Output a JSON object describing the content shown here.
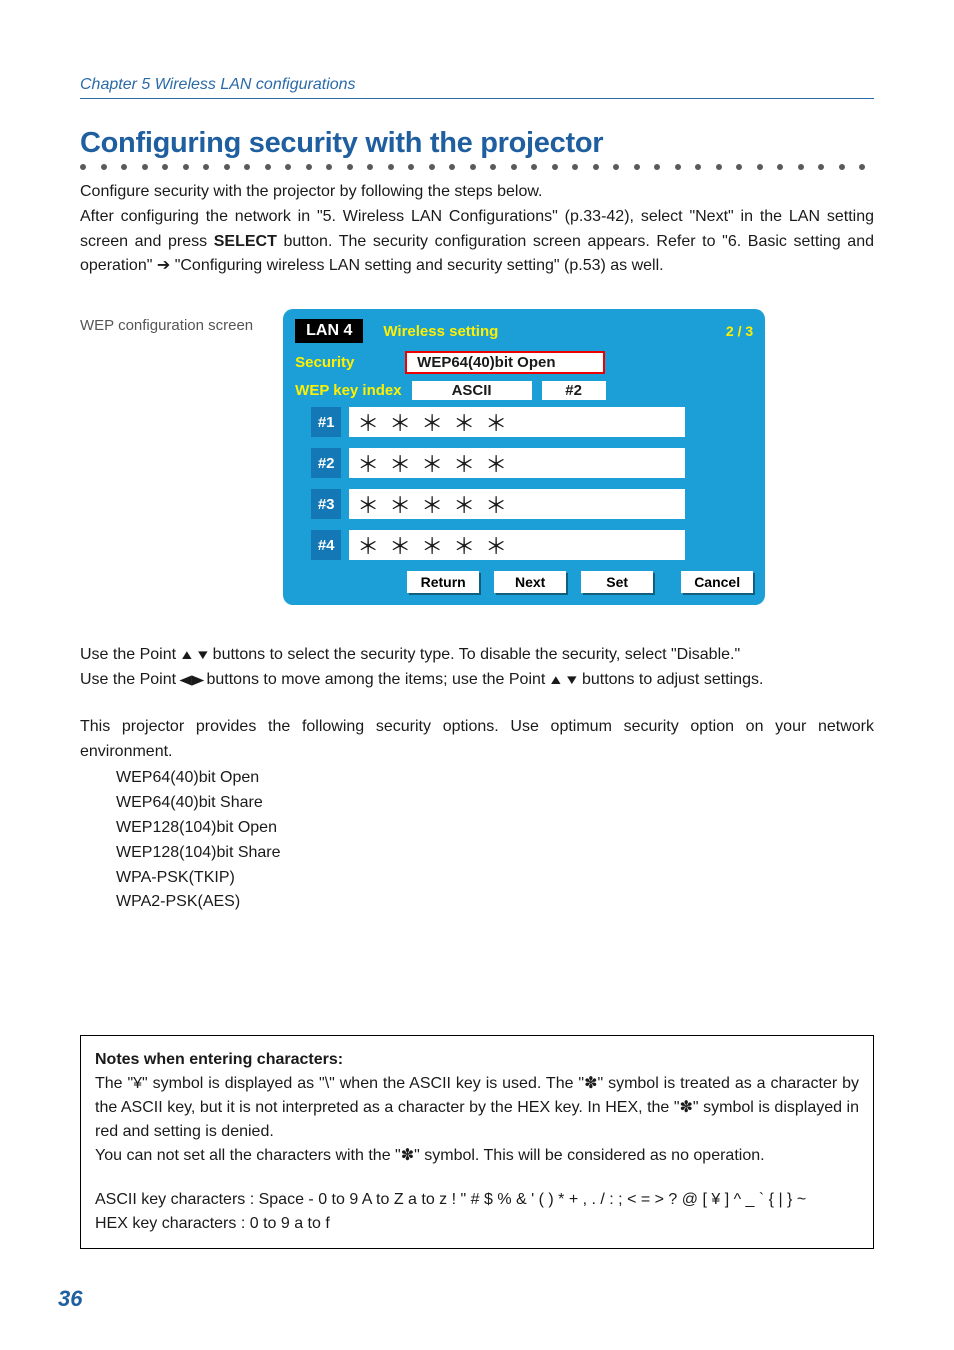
{
  "chapter": "Chapter 5 Wireless LAN configurations",
  "section_title": "Configuring security with the projector",
  "intro": {
    "line1": "Configure security with the projector by following the steps below.",
    "line2a": "After configuring the network in \"5. Wireless LAN Configurations\" (p.33-42), select \"Next\" in the LAN setting screen and press ",
    "line2b_bold": "SELECT",
    "line2c": " button. The security configuration screen appears. Refer to \"6. Basic setting and operation\" ",
    "arrow": "➔",
    "line2d": " \"Configuring wireless LAN setting and security setting\" (p.53) as well."
  },
  "screenshot_caption": "WEP configuration screen",
  "dialog": {
    "lan_label": "LAN 4",
    "wireless_setting": "Wireless setting",
    "page_indicator": "2 / 3",
    "security_label": "Security",
    "security_value": "WEP64(40)bit Open",
    "wep_index_label": "WEP key index",
    "ascii_label": "ASCII",
    "idx_value": "#2",
    "keys": [
      {
        "num": "#1",
        "value": "＊＊＊＊＊"
      },
      {
        "num": "#2",
        "value": "＊＊＊＊＊"
      },
      {
        "num": "#3",
        "value": "＊＊＊＊＊"
      },
      {
        "num": "#4",
        "value": "＊＊＊＊＊"
      }
    ],
    "buttons": {
      "return": "Return",
      "next": "Next",
      "set": "Set",
      "cancel": "Cancel"
    }
  },
  "body": {
    "p1a": "Use the Point ",
    "p1_ud": "▲▼",
    "p1b": " buttons to select the security type. To disable the security, select \"Disable.\"",
    "p2a": "Use the Point ",
    "p2_lr": "◀▶",
    "p2b": " buttons to move among the items; use the Point ",
    "p2_ud": "▲▼",
    "p2c": " buttons to adjust settings.",
    "p3": "This projector provides the following security options. Use optimum security option on your network environment.",
    "options": [
      "WEP64(40)bit Open",
      "WEP64(40)bit Share",
      "WEP128(104)bit Open",
      "WEP128(104)bit Share",
      "WPA-PSK(TKIP)",
      "WPA2-PSK(AES)"
    ]
  },
  "note": {
    "title": "Notes when entering characters:",
    "p1": "The \"¥\" symbol is displayed as \"\\\" when the ASCII key is used. The \"✽\" symbol is treated as a character by the ASCII key, but it is not interpreted as a character by the HEX key. In HEX, the \"✽\" symbol is displayed in red and setting is denied.",
    "p2": "You can not set all the characters with the \"✽\" symbol. This will be considered as no operation.",
    "p3": "ASCII key characters : Space - 0 to 9 A to Z a to z ! \" # $ % & ' ( ) * + , . / : ; < = > ? @ [ ¥ ] ^ _ ` { | } ~",
    "p4": "HEX key characters : 0 to 9 a to f"
  },
  "page_number": "36"
}
